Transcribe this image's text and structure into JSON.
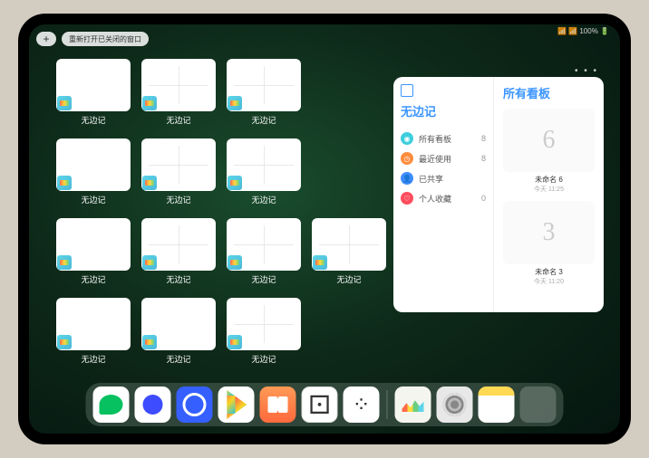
{
  "status": {
    "right": "📶 📶 100% 🔋"
  },
  "top": {
    "plus": "+",
    "reopen": "重新打开已关闭的窗口"
  },
  "app_name": "无边记",
  "thumbs": [
    {
      "type": "blank"
    },
    {
      "type": "grid"
    },
    {
      "type": "grid"
    },
    null,
    {
      "type": "blank"
    },
    {
      "type": "grid"
    },
    {
      "type": "grid"
    },
    null,
    {
      "type": "blank"
    },
    {
      "type": "grid"
    },
    {
      "type": "grid"
    },
    {
      "type": "grid"
    },
    {
      "type": "blank"
    },
    {
      "type": "blank"
    },
    {
      "type": "grid"
    },
    null
  ],
  "panel": {
    "left_title": "无边记",
    "right_title": "所有看板",
    "items": [
      {
        "icon": "◉",
        "bg": "#3dcedd",
        "label": "所有看板",
        "count": "8"
      },
      {
        "icon": "◷",
        "bg": "#ff8c3d",
        "label": "最近使用",
        "count": "8"
      },
      {
        "icon": "👤",
        "bg": "#3d8cff",
        "label": "已共享",
        "count": ""
      },
      {
        "icon": "♡",
        "bg": "#ff4d5e",
        "label": "个人收藏",
        "count": "0"
      }
    ],
    "boards": [
      {
        "glyph": "6",
        "name": "未命名 6",
        "date": "今天 11:25"
      },
      {
        "glyph": "3",
        "name": "未命名 3",
        "date": "今天 11:20"
      }
    ]
  },
  "dock": [
    {
      "name": "wechat"
    },
    {
      "name": "quark"
    },
    {
      "name": "circle"
    },
    {
      "name": "play"
    },
    {
      "name": "books"
    },
    {
      "name": "dice"
    },
    {
      "name": "dots"
    },
    {
      "sep": true
    },
    {
      "name": "freeform"
    },
    {
      "name": "settings"
    },
    {
      "name": "notes"
    },
    {
      "name": "folder"
    }
  ]
}
